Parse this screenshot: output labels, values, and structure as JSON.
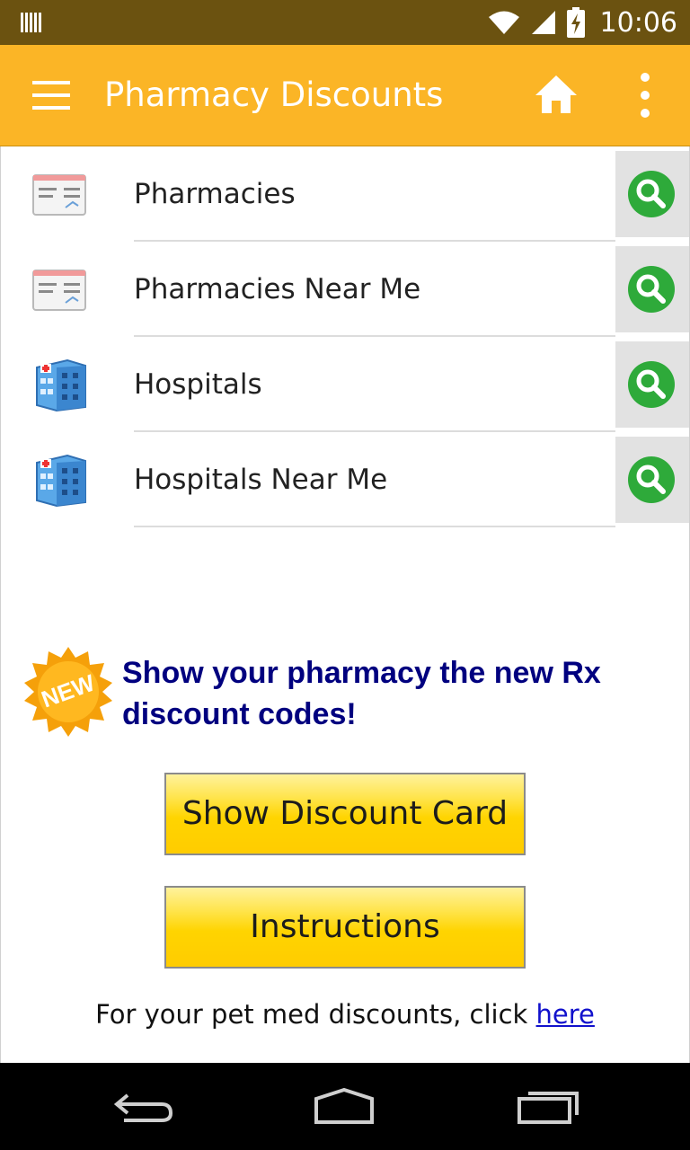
{
  "status_bar": {
    "time": "10:06",
    "icons": [
      "barcode-icon",
      "wifi-icon",
      "signal-icon",
      "battery-charging-icon"
    ]
  },
  "app_bar": {
    "title": "Pharmacy Discounts",
    "icons": [
      "menu-icon",
      "home-icon",
      "overflow-menu-icon"
    ],
    "background": "#fbb526"
  },
  "list": {
    "items": [
      {
        "label": "Pharmacies",
        "icon": "card-icon",
        "action_icon": "search-icon"
      },
      {
        "label": "Pharmacies Near Me",
        "icon": "card-icon",
        "action_icon": "search-icon"
      },
      {
        "label": "Hospitals",
        "icon": "hospital-icon",
        "action_icon": "search-icon"
      },
      {
        "label": "Hospitals Near Me",
        "icon": "hospital-icon",
        "action_icon": "search-icon"
      }
    ]
  },
  "promo": {
    "badge": "NEW",
    "text": "Show your pharmacy the new Rx discount codes!",
    "text_color": "#00007f"
  },
  "buttons": {
    "show_card": "Show Discount Card",
    "instructions": "Instructions"
  },
  "pet": {
    "text": "For your pet med discounts, click ",
    "link": "here"
  },
  "nav_bar": {
    "icons": [
      "back-icon",
      "home-nav-icon",
      "recents-icon"
    ]
  }
}
